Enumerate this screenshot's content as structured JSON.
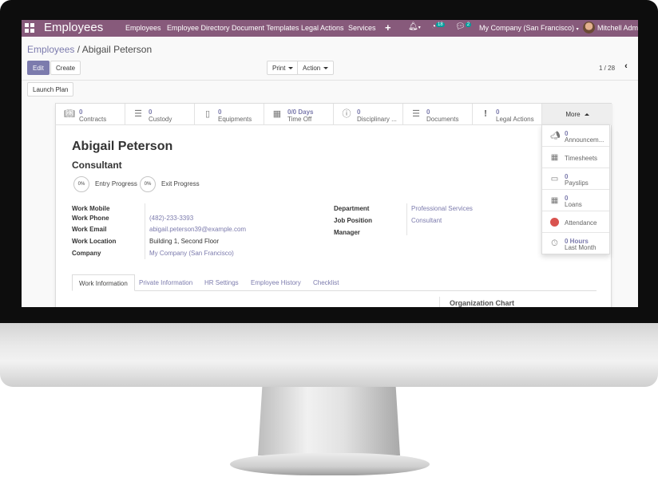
{
  "nav": {
    "app_title": "Employees",
    "menu": [
      "Employees",
      "Employee Directory",
      "Document Templates",
      "Legal Actions",
      "Services"
    ],
    "activity_count": "18",
    "message_count": "2",
    "company": "My Company (San Francisco)",
    "user": "Mitchell Admin"
  },
  "breadcrumb": {
    "parent": "Employees",
    "current": "Abigail Peterson"
  },
  "toolbar": {
    "edit": "Edit",
    "create": "Create",
    "print": "Print",
    "action": "Action",
    "launch_plan": "Launch Plan"
  },
  "pager": {
    "text": "1 / 28"
  },
  "stat_buttons": [
    {
      "value": "0",
      "label": "Contracts",
      "icon": "book-icon"
    },
    {
      "value": "0",
      "label": "Custody",
      "icon": "list-icon"
    },
    {
      "value": "0",
      "label": "Equipments",
      "icon": "mobile-icon"
    },
    {
      "value": "0/0 Days",
      "label": "Time Off",
      "icon": "calendar-icon"
    },
    {
      "value": "0",
      "label": "Disciplinary ...",
      "icon": "info-icon"
    },
    {
      "value": "0",
      "label": "Documents",
      "icon": "list-icon"
    },
    {
      "value": "0",
      "label": "Legal Actions",
      "icon": "exclamation-icon"
    }
  ],
  "more_label": "More",
  "more_menu": [
    {
      "value": "0",
      "label": "Announcem...",
      "icon": "bullhorn-icon"
    },
    {
      "value": "",
      "label": "Timesheets",
      "icon": "calendar-icon"
    },
    {
      "value": "0",
      "label": "Payslips",
      "icon": "credit-card-icon"
    },
    {
      "value": "0",
      "label": "Loans",
      "icon": "calendar-icon"
    },
    {
      "value": "",
      "label": "Attendance",
      "icon": "red-dot-icon"
    },
    {
      "value": "0 Hours",
      "label": "Last Month",
      "icon": "clock-icon"
    }
  ],
  "employee": {
    "name": "Abigail Peterson",
    "job_title": "Consultant",
    "entry_progress": "0%",
    "entry_label": "Entry Progress",
    "exit_progress": "0%",
    "exit_label": "Exit Progress"
  },
  "left_fields": [
    {
      "label": "Work Mobile",
      "value": ""
    },
    {
      "label": "Work Phone",
      "value": "(482)-233-3393"
    },
    {
      "label": "Work Email",
      "value": "abigail.peterson39@example.com"
    },
    {
      "label": "Work Location",
      "value": "Building 1, Second Floor"
    },
    {
      "label": "Company",
      "value": "My Company (San Francisco)"
    }
  ],
  "right_fields": [
    {
      "label": "Department",
      "value": "Professional Services"
    },
    {
      "label": "Job Position",
      "value": "Consultant"
    },
    {
      "label": "Manager",
      "value": ""
    }
  ],
  "tabs": [
    "Work Information",
    "Private Information",
    "HR Settings",
    "Employee History",
    "Checklist"
  ],
  "org_chart_title": "Organization Chart",
  "colors": {
    "brand": "#875a7b",
    "accent": "#7c7bad",
    "attendance": "#d9534f"
  }
}
